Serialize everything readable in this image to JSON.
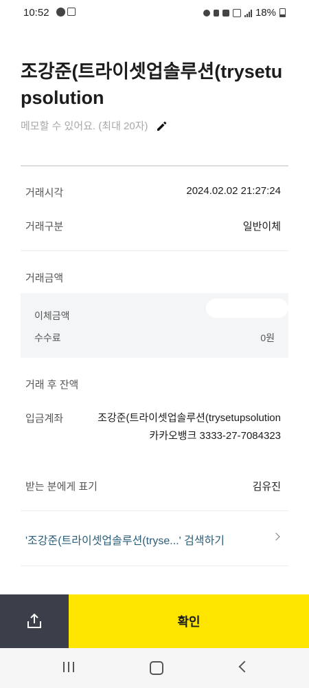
{
  "status": {
    "time": "10:52",
    "battery": "18%"
  },
  "header": {
    "title": "조강준(트라이셋업솔루션(trysetupsolution",
    "memo_placeholder": "메모할 수 있어요. (최대 20자)"
  },
  "details": {
    "time_label": "거래시각",
    "time_value": "2024.02.02 21:27:24",
    "type_label": "거래구분",
    "type_value": "일반이체",
    "amount_label": "거래금액",
    "transfer_amount_label": "이체금액",
    "fee_label": "수수료",
    "fee_value": "0원",
    "balance_label": "거래 후 잔액",
    "account_label": "입금계좌",
    "account_name": "조강준(트라이셋업솔루션(trysetupsolution",
    "account_bank": "카카오뱅크 3333-27-7084323",
    "recipient_label": "받는 분에게 표기",
    "recipient_value": "김유진"
  },
  "search": {
    "link_text": "'조강준(트라이셋업솔루션(tryse...' 검색하기"
  },
  "actions": {
    "confirm_label": "확인",
    "share_icon": "share-icon"
  },
  "navigation": {
    "recent_icon": "recent-apps-icon",
    "home_icon": "home-icon",
    "back_icon": "back-icon"
  },
  "colors": {
    "accent": "#fee500",
    "share_bg": "#3a3f49",
    "link": "#2a5d79"
  }
}
